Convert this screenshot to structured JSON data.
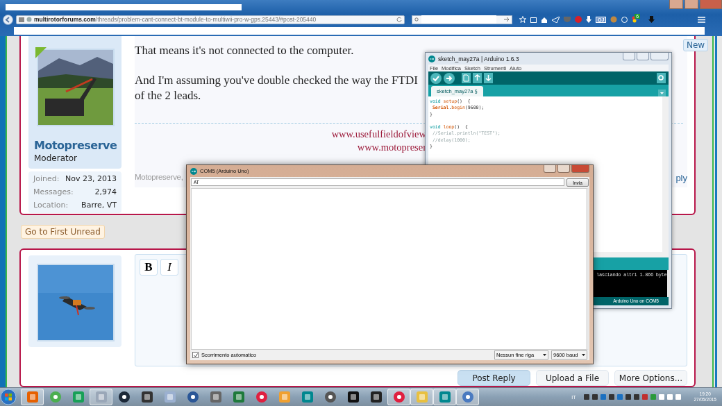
{
  "browser": {
    "url_host": "multirotorforums.com",
    "url_path": "/threads/problem-cant-connect-bt-module-to-multiwii-pro-w-gps.25443/#post-205440",
    "extension_label": "QJ",
    "badge_count": "6"
  },
  "new_badge": "New",
  "post": {
    "avatar": {
      "kind": "picture"
    },
    "username": "Motopreserve",
    "role": "Moderator",
    "stats": [
      {
        "label": "Joined:",
        "value": "Nov 23, 2013"
      },
      {
        "label": "Messages:",
        "value": "2,974"
      },
      {
        "label": "Location:",
        "value": "Barre, VT"
      }
    ],
    "paragraphs": [
      [
        "That means it's not connected to the computer."
      ],
      [
        "And I'm assuming you've double checked the way the FTDI",
        "of the 2 leads."
      ]
    ],
    "signature": [
      "www.usefulfieldofview",
      "www.motopreser"
    ],
    "footer_author": "Motopreserve,",
    "reply_link": "ply"
  },
  "first_unread_button": "Go to First Unread",
  "editor": {
    "avatar": {
      "kind": "picture"
    },
    "format_buttons": [
      {
        "label": "B",
        "kind": "bold"
      },
      {
        "label": "I",
        "kind": "italic"
      }
    ],
    "buttons": [
      {
        "label": "Post Reply",
        "primary": true
      },
      {
        "label": "Upload a File",
        "primary": false
      },
      {
        "label": "More Options...",
        "primary": false
      }
    ]
  },
  "ide_window": {
    "title": "sketch_may27a | Arduino 1.6.3",
    "menu": [
      "File",
      "Modifica",
      "Sketch",
      "Strumenti",
      "Aiuto"
    ],
    "tab": "sketch_may27a §",
    "code": [
      [
        [
          {
            "text": "void",
            "kind": "type"
          },
          {
            "text": " setup",
            "kind": "function"
          },
          {
            "text": "()  {",
            "kind": "plain"
          }
        ],
        [
          {
            "text": " Serial",
            "kind": "class"
          },
          {
            "text": ".",
            "kind": "plain"
          },
          {
            "text": "begin",
            "kind": "function"
          },
          {
            "text": "(9600);",
            "kind": "plain"
          }
        ],
        [
          {
            "text": "}",
            "kind": "plain"
          }
        ]
      ],
      [
        [
          {
            "text": "void",
            "kind": "type"
          },
          {
            "text": " loop",
            "kind": "function"
          },
          {
            "text": "()  {",
            "kind": "plain"
          }
        ],
        [
          {
            "text": " //Serial.println(\"TEST\");",
            "kind": "comment"
          }
        ],
        [
          {
            "text": " //delay(1000);",
            "kind": "comment"
          }
        ],
        [
          {
            "text": "}",
            "kind": "plain"
          }
        ]
      ]
    ],
    "console": "lasciando altri 1.866 byte",
    "status": "Arduino Uno on COM5"
  },
  "serial_monitor": {
    "title": "COM5 (Arduino Uno)",
    "input": "AT",
    "send_button": "Invia",
    "autoscroll": {
      "label": "Scorrimento automatico",
      "checked": true
    },
    "line_ending": "Nessun fine riga",
    "baud": "9600 baud"
  },
  "taskbar": {
    "apps": [
      {
        "open": true
      },
      {
        "open": false
      },
      {
        "open": false
      },
      {
        "open": true
      },
      {
        "open": false
      },
      {
        "open": false
      },
      {
        "open": false
      },
      {
        "open": false
      },
      {
        "open": false
      },
      {
        "open": false
      },
      {
        "open": false
      },
      {
        "open": false
      },
      {
        "open": false
      },
      {
        "open": false
      },
      {
        "open": false
      },
      {
        "open": false
      },
      {
        "open": true
      },
      {
        "open": true
      },
      {
        "open": true
      },
      {
        "open": true
      }
    ],
    "language": "IT",
    "time": "19:20",
    "date": "27/05/2015"
  }
}
